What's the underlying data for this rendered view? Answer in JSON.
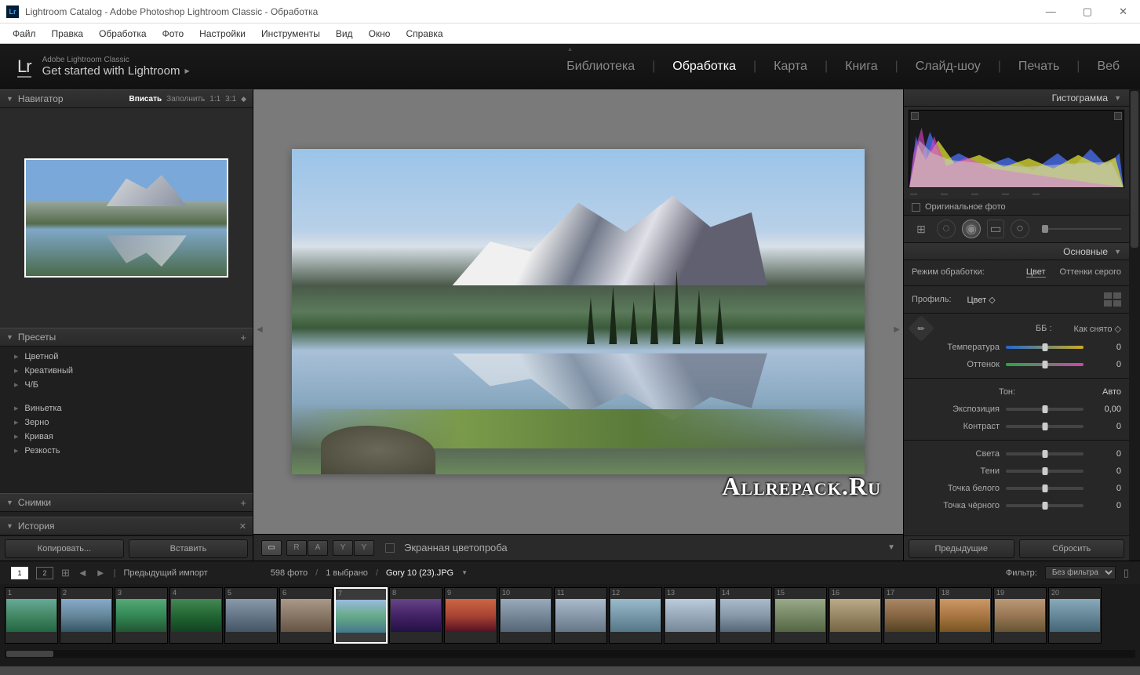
{
  "window": {
    "title": "Lightroom Catalog - Adobe Photoshop Lightroom Classic - Обработка",
    "app_icon": "Lr"
  },
  "menu": [
    "Файл",
    "Правка",
    "Обработка",
    "Фото",
    "Настройки",
    "Инструменты",
    "Вид",
    "Окно",
    "Справка"
  ],
  "header": {
    "brand_small": "Adobe Lightroom Classic",
    "brand_big": "Get started with Lightroom",
    "modules": [
      "Библиотека",
      "Обработка",
      "Карта",
      "Книга",
      "Слайд-шоу",
      "Печать",
      "Веб"
    ],
    "active_module": "Обработка"
  },
  "left": {
    "navigator": {
      "title": "Навигатор",
      "fit": "Вписать",
      "fill": "Заполнить",
      "one": "1:1",
      "ratio": "3:1"
    },
    "presets_title": "Пресеты",
    "presets": [
      "Цветной",
      "Креативный",
      "Ч/Б"
    ],
    "presets2": [
      "Виньетка",
      "Зерно",
      "Кривая",
      "Резкость"
    ],
    "snapshots": "Снимки",
    "history": "История",
    "copy": "Копировать...",
    "paste": "Вставить"
  },
  "toolbar": {
    "loupe": "▣",
    "before_after": "R|A",
    "before_after2": "Y|Y",
    "softproof": "Экранная цветопроба"
  },
  "right": {
    "histogram": "Гистограмма",
    "original": "Оригинальное фото",
    "basic": "Основные",
    "treatment": "Режим обработки:",
    "color": "Цвет",
    "bw": "Оттенки серого",
    "profile": "Профиль:",
    "profile_val": "Цвет",
    "wb": "ББ :",
    "wb_val": "Как снято",
    "temp": "Температура",
    "temp_val": "0",
    "tint": "Оттенок",
    "tint_val": "0",
    "tone": "Тон:",
    "auto": "Авто",
    "exposure": "Экспозиция",
    "exposure_val": "0,00",
    "contrast": "Контраст",
    "contrast_val": "0",
    "highlights": "Света",
    "highlights_val": "0",
    "shadows": "Тени",
    "shadows_val": "0",
    "whites": "Точка белого",
    "whites_val": "0",
    "blacks": "Точка чёрного",
    "blacks_val": "0",
    "previous": "Предыдущие",
    "reset": "Сбросить"
  },
  "filmhead": {
    "prev_import": "Предыдущий импорт",
    "count": "598 фото",
    "selected": "1 выбрано",
    "filename": "Gory 10 (23).JPG",
    "filter": "Фильтр:",
    "filter_val": "Без фильтра"
  },
  "watermark": "Allrepack.Ru",
  "thumbs_count": 20,
  "selected_thumb": 7
}
